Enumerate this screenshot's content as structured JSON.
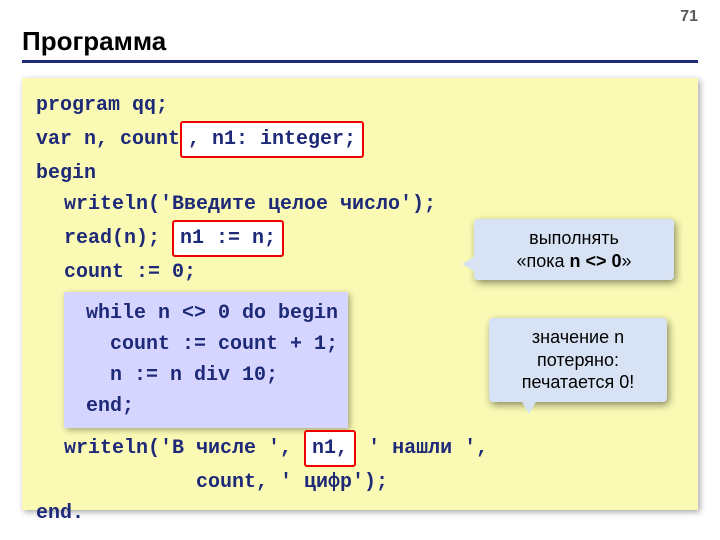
{
  "page": {
    "number": "71",
    "title": "Программа"
  },
  "code": {
    "l1": "program qq;",
    "l2_pre": "var n, count",
    "l2_box": ", n1: integer;",
    "l3": "begin",
    "l4": "writeln('Введите целое число');",
    "l5_pre": "read(n); ",
    "l5_box": "n1 := n;",
    "l6": "count := 0;",
    "while_block": " while n <> 0 do begin\n   count := count + 1;\n   n := n div 10;\n end;",
    "l8_pre": "writeln('В числе ', ",
    "l8_box": "n1,",
    "l8_post": " ' нашли ',",
    "l9": "count, ' цифр');",
    "l10": "end."
  },
  "callouts": {
    "c1_pre": "выполнять",
    "c1_bold_pre": "«пока ",
    "c1_expr": "n <> 0",
    "c1_bold_post": "»",
    "c2_l1": "значение n",
    "c2_l2": "потеряно:",
    "c2_l3": "печатается 0!"
  }
}
